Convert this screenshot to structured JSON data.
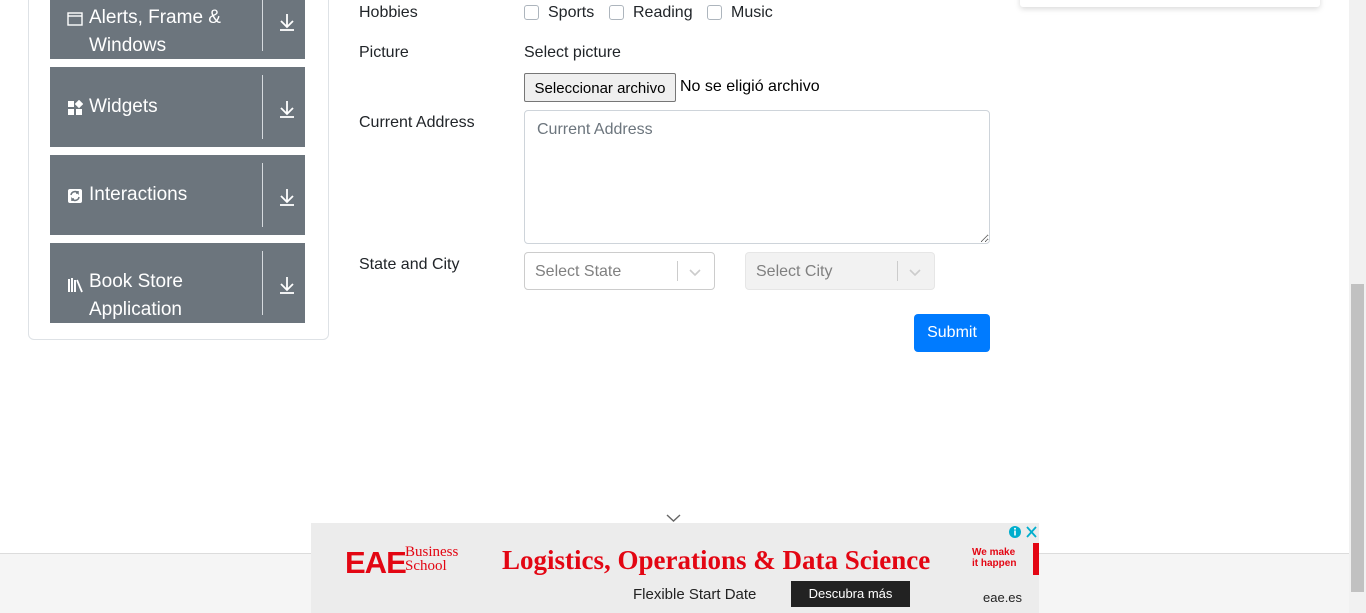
{
  "sidebar": {
    "groups": [
      {
        "label": "Alerts, Frame & Windows",
        "icon": "window-icon"
      },
      {
        "label": "Widgets",
        "icon": "widgets-icon"
      },
      {
        "label": "Interactions",
        "icon": "interactions-icon"
      },
      {
        "label": "Book Store Application",
        "icon": "books-icon"
      }
    ]
  },
  "form": {
    "hobbies_label": "Hobbies",
    "hobbies": [
      {
        "label": "Sports",
        "checked": false
      },
      {
        "label": "Reading",
        "checked": false
      },
      {
        "label": "Music",
        "checked": false
      }
    ],
    "picture_label": "Picture",
    "picture_hint": "Select picture",
    "file_button": "Seleccionar archivo",
    "file_status": "No se eligió archivo",
    "address_label": "Current Address",
    "address_placeholder": "Current Address",
    "state_city_label": "State and City",
    "state_placeholder": "Select State",
    "city_placeholder": "Select City",
    "submit_label": "Submit"
  },
  "ad": {
    "brand": "EAE",
    "brand_sub_1": "Business",
    "brand_sub_2": "School",
    "headline": "Logistics, Operations & Data Science",
    "tagline_1": "We make",
    "tagline_2": "it happen",
    "subline": "Flexible Start Date",
    "cta": "Descubra más",
    "domain": "eae.es",
    "accent": "#e30613"
  },
  "colors": {
    "sidebar_group_bg": "#6c757d",
    "primary": "#007bff"
  }
}
